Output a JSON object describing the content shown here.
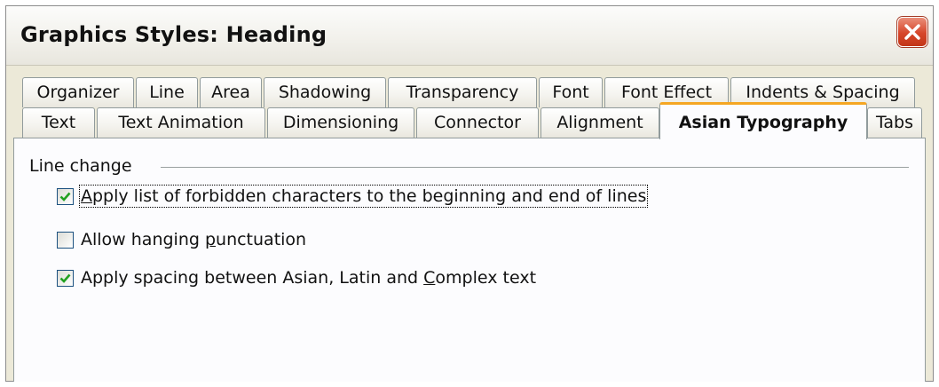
{
  "window": {
    "title": "Graphics Styles: Heading"
  },
  "tabs": {
    "row1": [
      "Organizer",
      "Line",
      "Area",
      "Shadowing",
      "Transparency",
      "Font",
      "Font Effect",
      "Indents & Spacing"
    ],
    "row2": [
      "Text",
      "Text Animation",
      "Dimensioning",
      "Connector",
      "Alignment",
      "Asian Typography",
      "Tabs"
    ],
    "active": "Asian Typography"
  },
  "section": {
    "label": "Line change",
    "options": [
      {
        "pre": "",
        "mnemonic": "A",
        "post": "pply list of forbidden characters to the beginning and end of lines",
        "checked": true,
        "focused": true
      },
      {
        "pre": "Allow hanging ",
        "mnemonic": "p",
        "post": "unctuation",
        "checked": false,
        "focused": false
      },
      {
        "pre": "Apply spacing between Asian, Latin and ",
        "mnemonic": "C",
        "post": "omplex text",
        "checked": true,
        "focused": false
      }
    ]
  },
  "colors": {
    "accent": "#f5a623",
    "check": "#21a121",
    "close": "#d6452a"
  },
  "icons": {
    "close": "close-x-icon",
    "check": "checkmark-icon"
  }
}
